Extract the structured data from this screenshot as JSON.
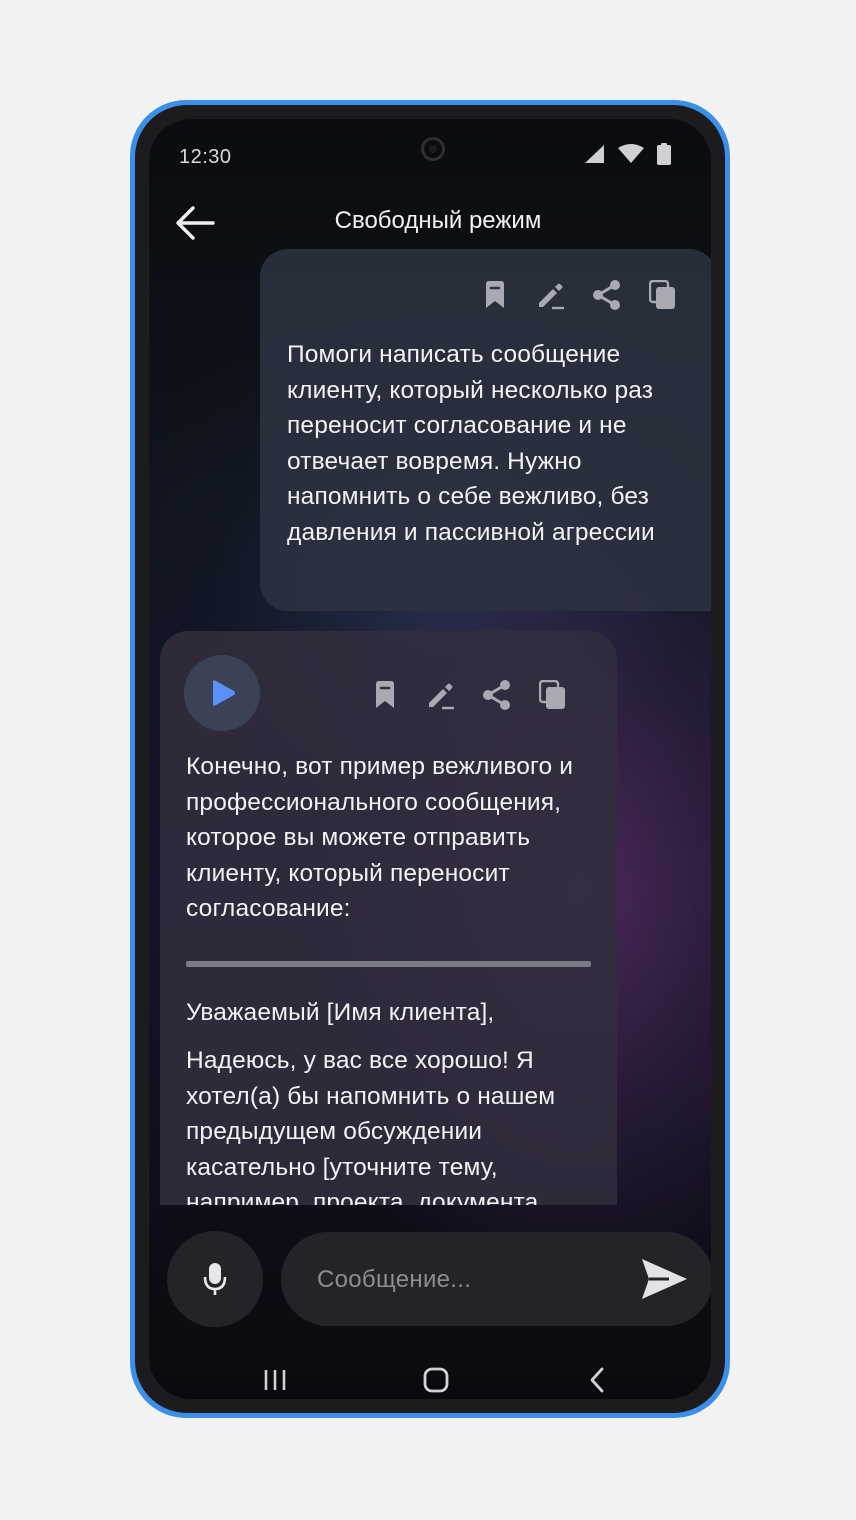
{
  "status_bar": {
    "time": "12:30",
    "icons": [
      "signal-icon",
      "wifi-icon",
      "battery-icon"
    ]
  },
  "header": {
    "title": "Свободный режим",
    "back_icon": "arrow-left-icon"
  },
  "messages": [
    {
      "role": "user",
      "actions": [
        "bookmark-icon",
        "edit-icon",
        "share-icon",
        "copy-icon"
      ],
      "text": "Помоги написать сообщение клиенту, который несколько раз переносит согласование и не отвечает вовремя. Нужно напомнить о себе вежливо, без давления и пассивной агрессии"
    },
    {
      "role": "assistant",
      "play_icon": "play-icon",
      "actions": [
        "bookmark-icon",
        "edit-icon",
        "share-icon",
        "copy-icon"
      ],
      "intro": "Конечно, вот пример вежливого и профессионального сообщения, которое вы можете отправить клиенту, который переносит согласование:",
      "greeting": "Уважаемый [Имя клиента],",
      "body": "Надеюсь, у вас все хорошо! Я хотел(а) бы напомнить о нашем предыдущем обсуждении касательно [уточните тему, например, проекта, документа"
    }
  ],
  "composer": {
    "mic_icon": "microphone-icon",
    "placeholder": "Сообщение...",
    "value": "",
    "send_icon": "send-icon"
  },
  "nav_bar": {
    "buttons": [
      "recent-apps-icon",
      "home-icon",
      "back-icon"
    ]
  },
  "colors": {
    "device_frame": "#3a8fe8",
    "play_accent": "#5b8ff9",
    "bubble_user": "#2c3240",
    "bubble_assistant": "#322e3e"
  }
}
